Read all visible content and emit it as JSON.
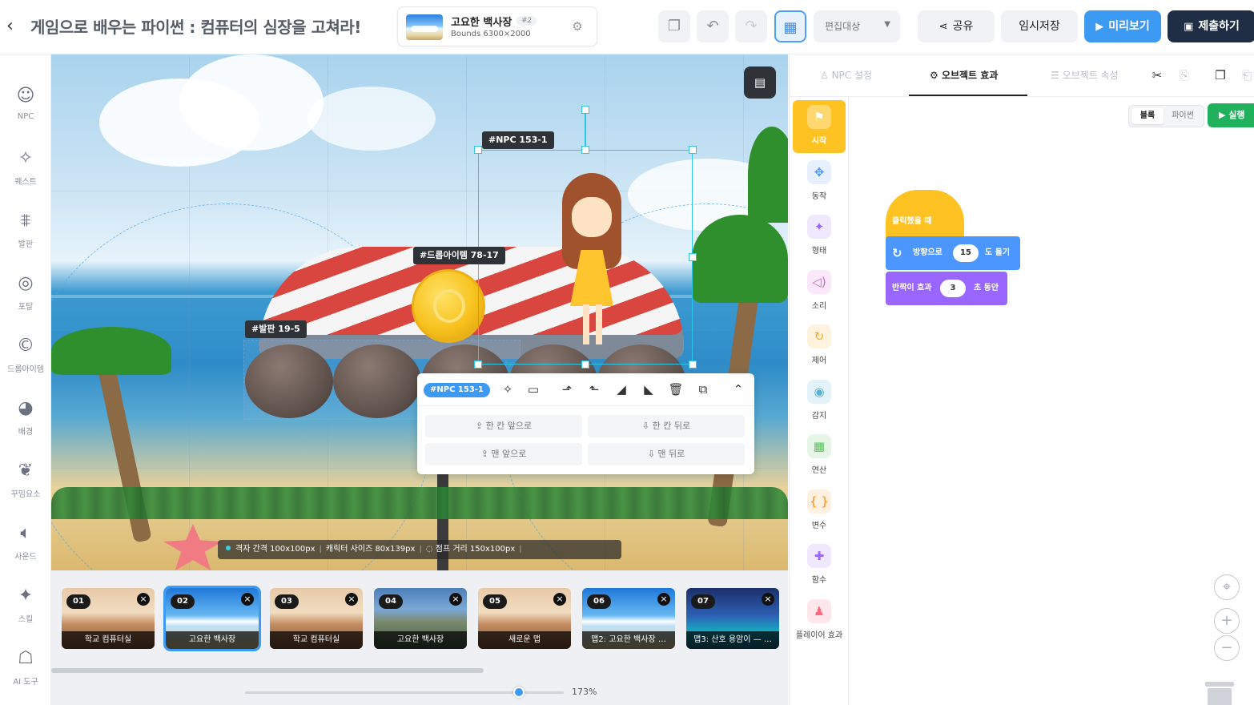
{
  "header": {
    "title": "게임으로 배우는 파이썬 : 컴퓨터의 심장을 고쳐라!",
    "map_name": "고요한 백사장",
    "map_tag": "#2",
    "map_bounds": "Bounds 6300×2000",
    "edit_target": "편집대상",
    "share_label": "공유",
    "temp_save_label": "임시저장",
    "preview_label": "미리보기",
    "submit_label": "제출하기"
  },
  "left_toolbar": [
    {
      "label": "NPC",
      "icon": "smile-icon"
    },
    {
      "label": "퀘스트",
      "icon": "sparkle-icon"
    },
    {
      "label": "발판",
      "icon": "platform-icon"
    },
    {
      "label": "포탈",
      "icon": "portal-icon"
    },
    {
      "label": "드롭아이템",
      "icon": "coin-icon"
    },
    {
      "label": "배경",
      "icon": "palette-icon"
    },
    {
      "label": "꾸밈요소",
      "icon": "leaf-icon"
    },
    {
      "label": "사운드",
      "icon": "speaker-icon"
    },
    {
      "label": "스킬",
      "icon": "skill-icon"
    },
    {
      "label": "AI 도구",
      "icon": "robot-icon"
    }
  ],
  "canvas": {
    "labels": {
      "npc": "#NPC 153-1",
      "drop_item": "#드롭아이템 78-17",
      "platform": "#발판 19-5"
    },
    "context_menu": {
      "tag": "#NPC 153-1",
      "tools": [
        "sparkle-icon",
        "comment-icon",
        "rotate-left-icon",
        "rotate-right-icon",
        "flip-horizontal-icon",
        "flip-vertical-icon",
        "delete-icon",
        "duplicate-icon",
        "collapse-icon"
      ],
      "forward_one": "한 칸 앞으로",
      "backward_one": "한 칸 뒤로",
      "to_front": "맨 앞으로",
      "to_back": "맨 뒤로"
    },
    "status": {
      "grid": "격자 간격 100x100px",
      "char_size": "캐릭터 사이즈 80x139px",
      "jump": "점프 거리 150x100px"
    }
  },
  "scenes": [
    {
      "num": "01",
      "name": "학교 컴퓨터실",
      "bg": "school"
    },
    {
      "num": "02",
      "name": "고요한 백사장",
      "bg": "beach",
      "active": true
    },
    {
      "num": "03",
      "name": "학교 컴퓨터실",
      "bg": "school"
    },
    {
      "num": "04",
      "name": "고요한 백사장",
      "bg": "fall"
    },
    {
      "num": "05",
      "name": "새로운 맵",
      "bg": "school"
    },
    {
      "num": "06",
      "name": "맵2: 고요한 백사장 …",
      "bg": "beach"
    },
    {
      "num": "07",
      "name": "맵3: 산호 용암이 — …",
      "bg": "ocean"
    }
  ],
  "zoom": {
    "value": "173%",
    "level": 0.86
  },
  "right_panel": {
    "tabs": [
      {
        "label": "NPC 설정",
        "active": false
      },
      {
        "label": "오브젝트 효과",
        "active": true
      },
      {
        "label": "오브젝트 속성",
        "active": false
      }
    ],
    "categories": [
      {
        "label": "시작",
        "color": "#ffffff",
        "icon": "flag-icon",
        "active": true
      },
      {
        "label": "동작",
        "color": "#4c97ff",
        "icon": "move-icon"
      },
      {
        "label": "형태",
        "color": "#9966ff",
        "icon": "looks-icon"
      },
      {
        "label": "소리",
        "color": "#cf63cf",
        "icon": "sound-icon"
      },
      {
        "label": "제어",
        "color": "#ffab19",
        "icon": "control-icon"
      },
      {
        "label": "감지",
        "color": "#5cb1d6",
        "icon": "sensing-icon"
      },
      {
        "label": "연산",
        "color": "#59c059",
        "icon": "operator-icon"
      },
      {
        "label": "변수",
        "color": "#ff8c1a",
        "icon": "variable-icon"
      },
      {
        "label": "함수",
        "color": "#9966ff",
        "icon": "function-icon"
      },
      {
        "label": "플레이어 효과",
        "color": "#ff6680",
        "icon": "player-icon"
      }
    ],
    "mode_block": "블록",
    "mode_python": "파이썬",
    "run_label": "실행",
    "blocks": {
      "hat": "클릭했을 때",
      "motion_prefix": "방향으로",
      "motion_value": "15",
      "motion_suffix": "도 돌기",
      "looks_prefix": "반짝이 효과",
      "looks_value": "3",
      "looks_suffix": "초 동안"
    }
  }
}
